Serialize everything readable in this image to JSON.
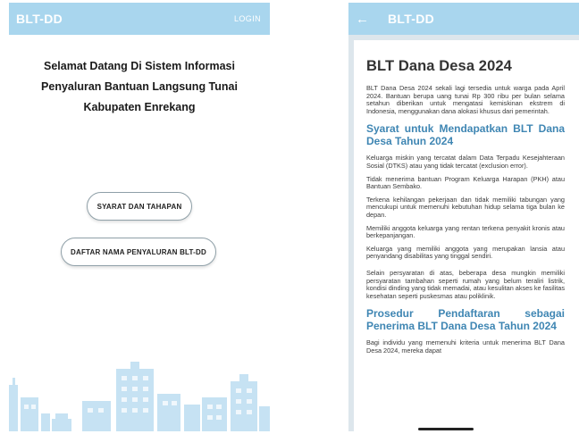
{
  "colors": {
    "appbar": "#a9d6ee",
    "heading_blue": "#3f86b3",
    "article_bg": "#ffffff",
    "screen_bg": "#dde6ec"
  },
  "left_screen": {
    "appbar": {
      "title": "BLT-DD",
      "login_label": "LOGIN"
    },
    "welcome_lines": [
      "Selamat Datang Di Sistem Informasi",
      "Penyaluran Bantuan Langsung Tunai",
      "Kabupaten Enrekang"
    ],
    "buttons": {
      "syarat_label": "SYARAT DAN TAHAPAN",
      "daftar_label": "DAFTAR NAMA PENYALURAN BLT-DD"
    },
    "illustration_icon": "city-skyline-icon"
  },
  "right_screen": {
    "appbar": {
      "back_icon": "arrow-left-icon",
      "title": "BLT-DD"
    },
    "article": {
      "title": "BLT Dana Desa 2024",
      "intro": "BLT Dana Desa 2024 sekali lagi tersedia untuk warga pada April 2024. Bantuan berupa uang tunai Rp 300 ribu per bulan selama setahun diberikan untuk mengatasi kemiskinan ekstrem di Indonesia, menggunakan dana alokasi khusus dari pemerintah.",
      "section1_heading": "Syarat untuk Mendapatkan BLT Dana Desa Tahun 2024",
      "section1_items": [
        "Keluarga miskin yang tercatat dalam Data Terpadu Kesejahteraan Sosial (DTKS) atau yang tidak tercatat (exclusion error).",
        "Tidak menerima bantuan Program Keluarga Harapan (PKH) atau Bantuan Sembako.",
        "Terkena kehilangan pekerjaan dan tidak memiliki tabungan yang mencukupi untuk memenuhi kebutuhan hidup selama tiga bulan ke depan.",
        "Memiliki anggota keluarga yang rentan terkena penyakit kronis atau berkepanjangan.",
        "Keluarga yang memiliki anggota yang merupakan lansia atau penyandang disabilitas yang tinggal sendiri."
      ],
      "section1_note": "Selain persyaratan di atas, beberapa desa mungkin memiliki persyaratan tambahan seperti rumah yang belum teraliri listrik, kondisi dinding yang tidak memadai, atau kesulitan akses ke fasilitas kesehatan seperti puskesmas atau poliklinik.",
      "section2_heading": "Prosedur Pendaftaran sebagai Penerima BLT Dana Desa Tahun 2024",
      "section2_intro": "Bagi individu yang memenuhi kriteria untuk menerima BLT Dana Desa 2024, mereka dapat"
    }
  }
}
